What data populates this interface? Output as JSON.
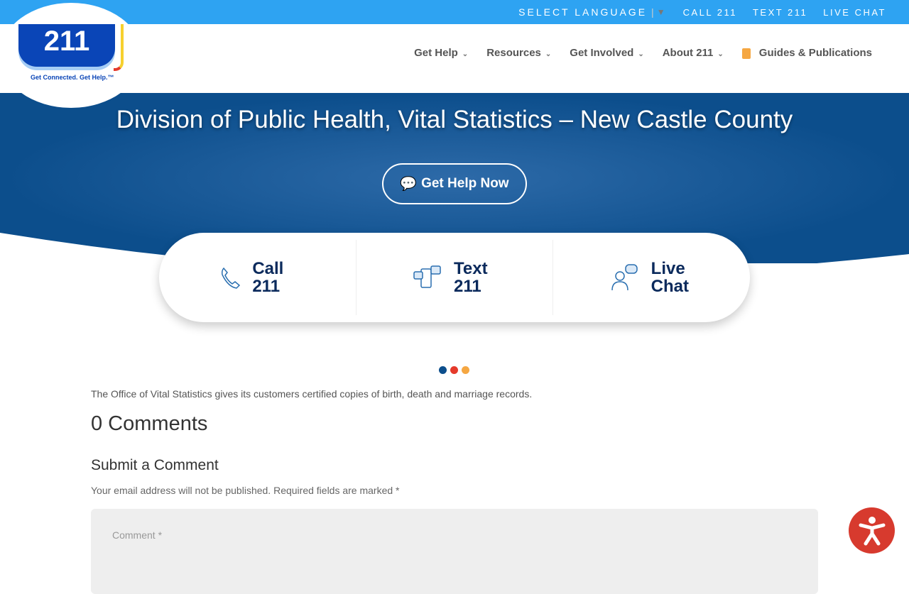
{
  "topbar": {
    "language": "SELECT LANGUAGE",
    "call": "CALL 211",
    "text": "TEXT 211",
    "chat": "LIVE CHAT"
  },
  "logo": {
    "number": "211",
    "tagline": "Get Connected. Get Help.™"
  },
  "nav": [
    "Get Help",
    "Resources",
    "Get Involved",
    "About 211",
    "Guides & Publications"
  ],
  "hero": {
    "title": "Division of Public Health, Vital Statistics – New Castle County",
    "button": "Get Help Now"
  },
  "cards": [
    {
      "l1": "Call",
      "l2": "211"
    },
    {
      "l1": "Text",
      "l2": "211"
    },
    {
      "l1": "Live",
      "l2": "Chat"
    }
  ],
  "colors": {
    "dot1": "#0c4e8c",
    "dot2": "#e53a2b",
    "dot3": "#f5a742"
  },
  "content": {
    "desc": "The Office of Vital Statistics gives its customers certified copies of birth, death and marriage records.",
    "comments": "0 Comments",
    "submit": "Submit a Comment",
    "note": "Your email address will not be published. Required fields are marked *",
    "comment_placeholder": "Comment *"
  }
}
